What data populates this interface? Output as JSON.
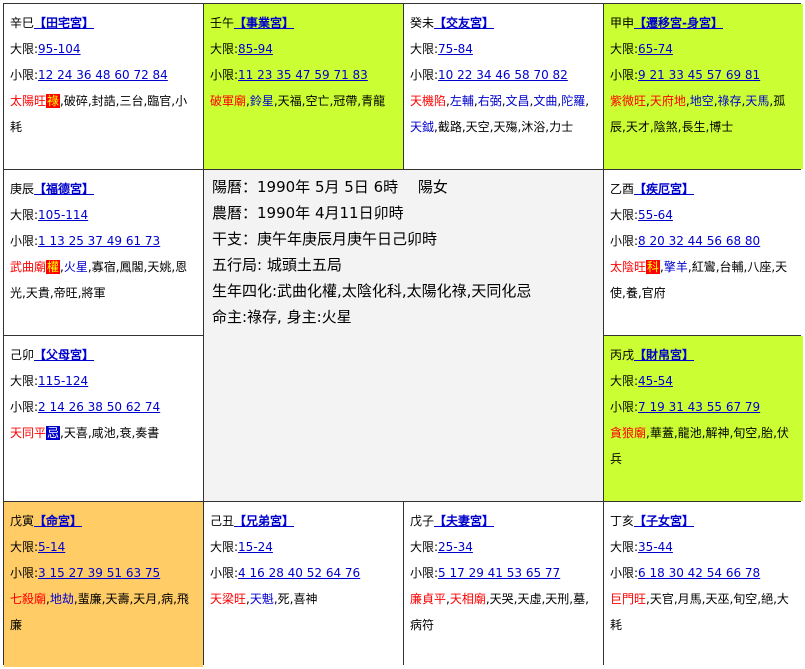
{
  "labels": {
    "daxian": "大限:",
    "xiaoxian": "小限:"
  },
  "cells": [
    {
      "stem": "辛巳",
      "palace": "【田宅宮】",
      "daxian": "95-104",
      "xiaoxian": "12 24 36 48 60 72 84",
      "stars": [
        {
          "t": "太陽旺",
          "c": "red"
        },
        {
          "t": "祿",
          "c": "hua"
        },
        {
          "t": ",破碎,封誥,三台,臨官,小耗",
          "c": ""
        }
      ]
    },
    {
      "stem": "壬午",
      "palace": "【事業宮】",
      "daxian": "85-94",
      "xiaoxian": "11 23 35 47 59 71 83",
      "stars": [
        {
          "t": "破軍廟",
          "c": "red"
        },
        {
          "t": ",",
          "c": ""
        },
        {
          "t": "鈴星",
          "c": "blue"
        },
        {
          "t": ",天福,空亡,冠帶,青龍",
          "c": ""
        }
      ]
    },
    {
      "stem": "癸未",
      "palace": "【交友宮】",
      "daxian": "75-84",
      "xiaoxian": "10 22 34 46 58 70 82",
      "stars": [
        {
          "t": "天機陷",
          "c": "red"
        },
        {
          "t": ",",
          "c": ""
        },
        {
          "t": "左輔",
          "c": "blue"
        },
        {
          "t": ",",
          "c": ""
        },
        {
          "t": "右弼",
          "c": "blue"
        },
        {
          "t": ",",
          "c": ""
        },
        {
          "t": "文昌",
          "c": "blue"
        },
        {
          "t": ",",
          "c": ""
        },
        {
          "t": "文曲",
          "c": "blue"
        },
        {
          "t": ",",
          "c": ""
        },
        {
          "t": "陀羅",
          "c": "blue"
        },
        {
          "t": ",",
          "c": ""
        },
        {
          "t": "天鉞",
          "c": "blue"
        },
        {
          "t": ",截路,天空,天殤,沐浴,力士",
          "c": ""
        }
      ]
    },
    {
      "stem": "甲申",
      "palace": "【遷移宮-身宮】",
      "daxian": "65-74",
      "xiaoxian": "9 21 33 45 57 69 81",
      "stars": [
        {
          "t": "紫微旺",
          "c": "red"
        },
        {
          "t": ",",
          "c": ""
        },
        {
          "t": "天府地",
          "c": "red"
        },
        {
          "t": ",",
          "c": ""
        },
        {
          "t": "地空",
          "c": "blue"
        },
        {
          "t": ",",
          "c": ""
        },
        {
          "t": "祿存",
          "c": "blue"
        },
        {
          "t": ",",
          "c": ""
        },
        {
          "t": "天馬",
          "c": "blue"
        },
        {
          "t": ",孤辰,天才,陰煞,長生,博士",
          "c": ""
        }
      ]
    },
    {
      "stem": "庚辰",
      "palace": "【福德宮】",
      "daxian": "105-114",
      "xiaoxian": "1 13 25 37 49 61 73",
      "stars": [
        {
          "t": "武曲廟",
          "c": "red"
        },
        {
          "t": "權",
          "c": "hua"
        },
        {
          "t": ",",
          "c": ""
        },
        {
          "t": "火星",
          "c": "blue"
        },
        {
          "t": ",寡宿,鳳閣,天姚,恩光,天貴,帝旺,將軍",
          "c": ""
        }
      ]
    },
    {
      "stem": "乙酉",
      "palace": "【疾厄宮】",
      "daxian": "55-64",
      "xiaoxian": "8 20 32 44 56 68 80",
      "stars": [
        {
          "t": "太陰旺",
          "c": "red"
        },
        {
          "t": "科",
          "c": "hua"
        },
        {
          "t": ",",
          "c": ""
        },
        {
          "t": "擎羊",
          "c": "blue"
        },
        {
          "t": ",紅鸞,台輔,八座,天使,養,官府",
          "c": ""
        }
      ]
    },
    {
      "stem": "己卯",
      "palace": "【父母宮】",
      "daxian": "115-124",
      "xiaoxian": "2 14 26 38 50 62 74",
      "stars": [
        {
          "t": "天同平",
          "c": "red"
        },
        {
          "t": "忌",
          "c": "huab"
        },
        {
          "t": ",天喜,咸池,衰,奏書",
          "c": ""
        }
      ]
    },
    {
      "stem": "丙戌",
      "palace": "【財帛宮】",
      "daxian": "45-54",
      "xiaoxian": "7 19 31 43 55 67 79",
      "stars": [
        {
          "t": "貪狼廟",
          "c": "red"
        },
        {
          "t": ",華蓋,龍池,解神,旬空,胎,伏兵",
          "c": ""
        }
      ]
    },
    {
      "stem": "戊寅",
      "palace": "【命宮】",
      "daxian": "5-14",
      "xiaoxian": "3 15 27 39 51 63 75",
      "stars": [
        {
          "t": "七殺廟",
          "c": "red"
        },
        {
          "t": ",",
          "c": ""
        },
        {
          "t": "地劫",
          "c": "blue"
        },
        {
          "t": ",蜚廉,天壽,天月,病,飛廉",
          "c": ""
        }
      ]
    },
    {
      "stem": "己丑",
      "palace": "【兄弟宮】",
      "daxian": "15-24",
      "xiaoxian": "4 16 28 40 52 64 76",
      "stars": [
        {
          "t": "天梁旺",
          "c": "red"
        },
        {
          "t": ",",
          "c": ""
        },
        {
          "t": "天魁",
          "c": "blue"
        },
        {
          "t": ",死,喜神",
          "c": ""
        }
      ]
    },
    {
      "stem": "戊子",
      "palace": "【夫妻宮】",
      "daxian": "25-34",
      "xiaoxian": "5 17 29 41 53 65 77",
      "stars": [
        {
          "t": "廉貞平",
          "c": "red"
        },
        {
          "t": ",",
          "c": ""
        },
        {
          "t": "天相廟",
          "c": "red"
        },
        {
          "t": ",天哭,天虛,天刑,墓,病符",
          "c": ""
        }
      ]
    },
    {
      "stem": "丁亥",
      "palace": "【子女宮】",
      "daxian": "35-44",
      "xiaoxian": "6 18 30 42 54 66 78",
      "stars": [
        {
          "t": "巨門旺",
          "c": "red"
        },
        {
          "t": ",天官,月馬,天巫,旬空,絕,大耗",
          "c": ""
        }
      ]
    }
  ],
  "center": {
    "lines": [
      "陽曆：1990年 5月 5日 6時　 陽女",
      "農曆：1990年 4月11日卯時",
      "干支：庚午年庚辰月庚午日己卯時",
      "五行局: 城頭土五局",
      "生年四化:武曲化權,太陰化科,太陽化祿,天同化忌",
      "命主:祿存, 身主:火星"
    ]
  }
}
